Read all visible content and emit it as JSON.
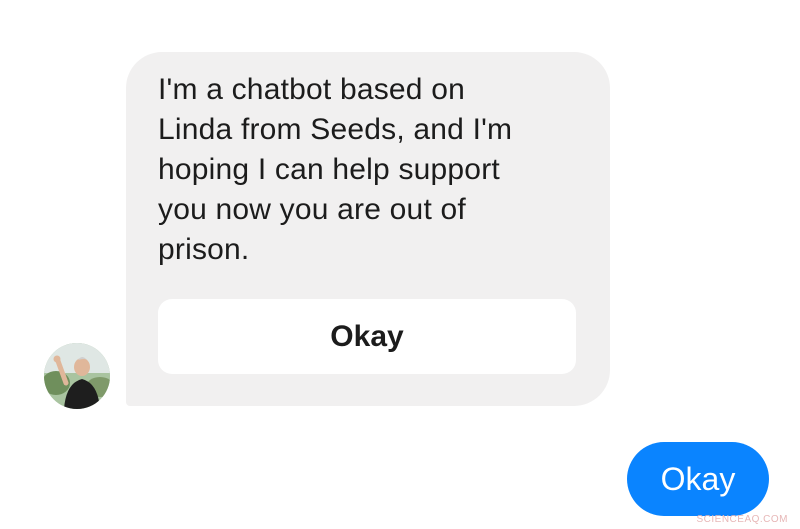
{
  "bot": {
    "avatar_icon": "person-photo-avatar",
    "message_lines": [
      "I'm a chatbot based on",
      "Linda from Seeds, and I'm",
      "hoping I can help support",
      "you now you are out of",
      "prison."
    ],
    "quick_reply_label": "Okay"
  },
  "user": {
    "message": "Okay"
  },
  "watermark": "SCIENCEAQ.COM",
  "colors": {
    "bot_bubble": "#f1f0f0",
    "user_bubble": "#0a84ff",
    "quick_reply_bg": "#ffffff"
  }
}
